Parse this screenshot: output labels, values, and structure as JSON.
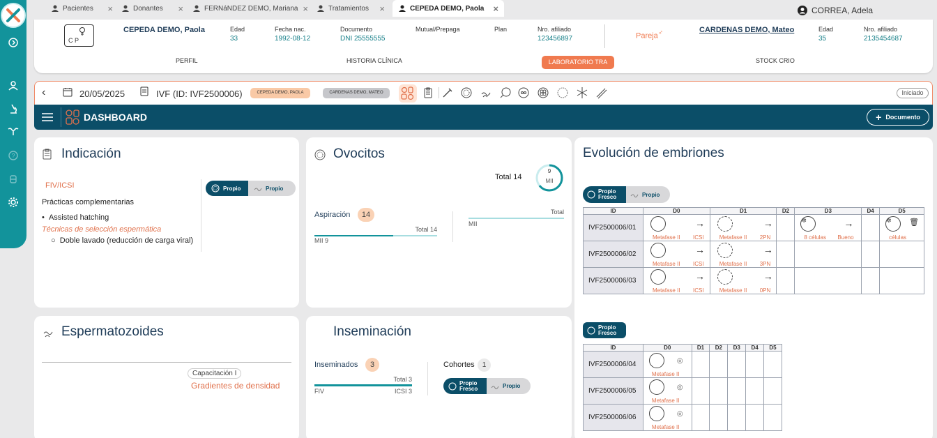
{
  "tabs": [
    {
      "label": "Pacientes"
    },
    {
      "label": "Donantes"
    },
    {
      "label": "FERNáNDEZ DEMO, Mariana"
    },
    {
      "label": "Tratamientos"
    },
    {
      "label": "CEPEDA DEMO, Paola"
    }
  ],
  "user": {
    "name": "CORREA, Adela"
  },
  "patient": {
    "avatar_text": "C P",
    "name": "CEPEDA DEMO, Paola",
    "edad_label": "Edad",
    "edad": "33",
    "fnac_label": "Fecha nac.",
    "fnac": "1992-08-12",
    "doc_label": "Documento",
    "doc": "DNI 25555555",
    "mutual_label": "Mutual/Prepaga",
    "plan_label": "Plan",
    "afil_label": "Nro. afiliado",
    "afil": "123456897",
    "pareja_label": "Pareja",
    "partner_name": "CARDENAS DEMO, Mateo",
    "partner_edad": "35",
    "partner_afil": "2135454687"
  },
  "ptabs": {
    "perfil": "PERFIL",
    "historia": "HISTORIA CLÍNICA",
    "laboratorio": "LABORATORIO TRA",
    "stock": "STOCK CRIO"
  },
  "toolbar": {
    "date": "20/05/2025",
    "treatment": "IVF",
    "treatment_id": "(ID: IVF2500006)",
    "chip_patient": "CEPEDA DEMO, PAOLA",
    "chip_partner": "CARDENAS DEMO, MATEO",
    "status": "Iniciado"
  },
  "dashbar": {
    "title": "DASHBOARD",
    "doc_button": "Documento"
  },
  "indicacion": {
    "title": "Indicación",
    "tech": "FIV/ICSI",
    "pract": "Prácticas complementarias",
    "item1": "Assisted hatching",
    "sel": "Técnicas de selección espermática",
    "item2": "Doble lavado (reducción de carga viral)",
    "toggle_on": "Propio",
    "toggle_off": "Propio"
  },
  "ovocitos": {
    "title": "Ovocitos",
    "total_label": "Total 14",
    "ring_num": "9",
    "ring_lbl": "MII",
    "mii_count": 9,
    "total_count": 14,
    "asp_label": "Aspiración",
    "asp_count": "14",
    "asp_total": "Total 14",
    "asp_sub": "MII 9",
    "right_total": "Total",
    "right_sub": "MII"
  },
  "esperma": {
    "title": "Espermatozoides",
    "cap": "Capacitación I",
    "grad": "Gradientes de densidad"
  },
  "inseminacion": {
    "title": "Inseminación",
    "ins_label": "Inseminados",
    "ins_count": "3",
    "total": "Total 3",
    "fiv": "FIV",
    "icsi": "ICSI 3",
    "coh_label": "Cohortes",
    "coh_count": "1",
    "toggle_on1": "Propio",
    "toggle_on2": "Fresco",
    "toggle_off": "Propio"
  },
  "evolucion": {
    "title": "Evolución de embriones",
    "toggle_on1": "Propio",
    "toggle_on2": "Fresco",
    "toggle_off": "Propio",
    "t1": {
      "headers": [
        "ID",
        "D0",
        "D1",
        "D2",
        "D3",
        "D4",
        "D5"
      ],
      "rows": [
        {
          "id": "IVF2500006/01",
          "d0a": "Metafase II",
          "d0b": "ICSI",
          "d1a": "Metafase II",
          "d1b": "2PN",
          "d3a": "8 células",
          "d3b": "Bueno",
          "d5a": "células"
        },
        {
          "id": "IVF2500006/02",
          "d0a": "Metafase II",
          "d0b": "ICSI",
          "d1a": "Metafase II",
          "d1b": "3PN"
        },
        {
          "id": "IVF2500006/03",
          "d0a": "Metafase II",
          "d0b": "ICSI",
          "d1a": "Metafase II",
          "d1b": "0PN"
        }
      ]
    },
    "t2": {
      "headers": [
        "ID",
        "D0",
        "D1",
        "D2",
        "D3",
        "D4",
        "D5"
      ],
      "rows": [
        {
          "id": "IVF2500006/04",
          "d0": "Metafase II"
        },
        {
          "id": "IVF2500006/05",
          "d0": "Metafase II"
        },
        {
          "id": "IVF2500006/06",
          "d0": "Metafase II"
        }
      ]
    }
  },
  "colors": {
    "teal": "#12939b",
    "navy": "#0b4e68",
    "accent": "#f07a4f"
  }
}
